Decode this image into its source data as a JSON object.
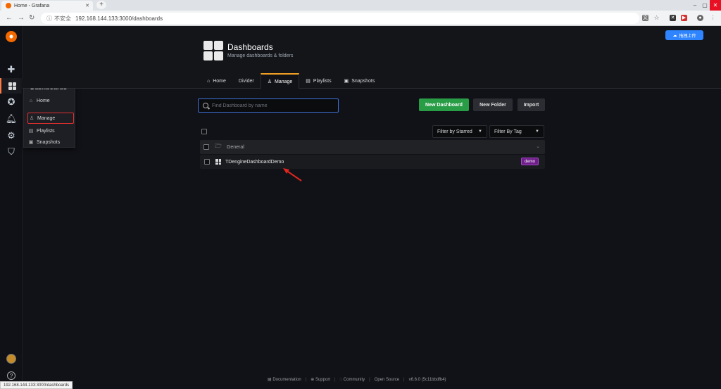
{
  "browser": {
    "tab_title": "Home - Grafana",
    "tab_close": "✕",
    "new_tab": "+",
    "security_label": "不安全",
    "url": "192.168.144.133:3000/dashboards",
    "status_url": "192.168.144.133:3000/dashboards"
  },
  "menu": {
    "heading": "Dashboards",
    "items": [
      {
        "label": "Home",
        "icon": "home-icon"
      },
      {
        "label": "Manage",
        "icon": "sitemap-icon"
      },
      {
        "label": "Playlists",
        "icon": "playlist-icon"
      },
      {
        "label": "Snapshots",
        "icon": "snapshot-icon"
      }
    ]
  },
  "header": {
    "title": "Dashboards",
    "subtitle": "Manage dashboards & folders",
    "tabs": [
      {
        "label": "Home",
        "icon": "home-icon"
      },
      {
        "label": "Divider",
        "icon": ""
      },
      {
        "label": "Manage",
        "icon": "sitemap-icon"
      },
      {
        "label": "Playlists",
        "icon": "playlist-icon"
      },
      {
        "label": "Snapshots",
        "icon": "snapshot-icon"
      }
    ],
    "upload_label": "拖拽上传"
  },
  "content": {
    "search_placeholder": "Find Dashboard by name",
    "new_dashboard_label": "New Dashboard",
    "new_folder_label": "New Folder",
    "import_label": "Import",
    "filter_starred_label": "Filter by Starred",
    "filter_tag_label": "Filter By Tag",
    "folder_name": "General",
    "dashboard_name": "TDengineDashboardDemo",
    "dashboard_tag": "demo"
  },
  "footer": {
    "documentation": "Documentation",
    "support": "Support",
    "community": "Community",
    "open_source": "Open Source",
    "version": "v6.6.0 (5c11bbdfb4)"
  },
  "colors": {
    "accent": "#f0a022",
    "primary_green": "#299c46",
    "focus_blue": "#3d71d9",
    "tag_purple": "#6f1d8a",
    "highlight_red": "#e02f2f"
  }
}
